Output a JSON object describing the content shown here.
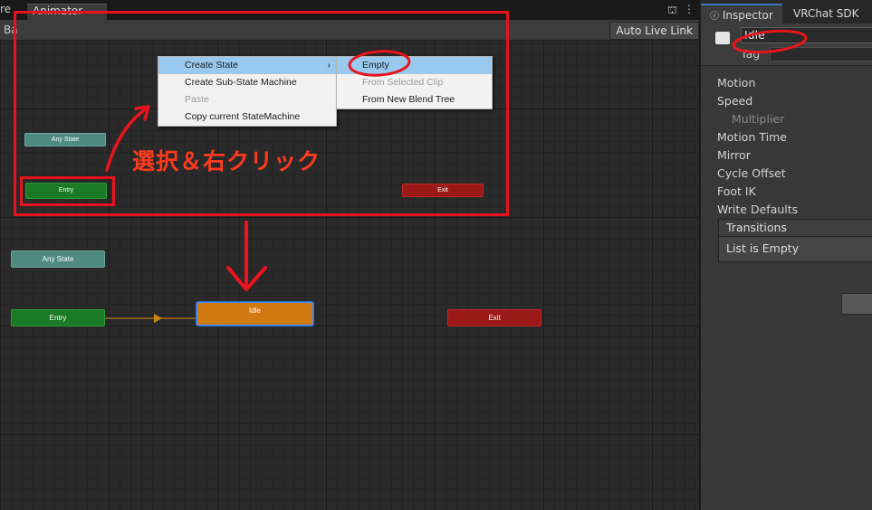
{
  "animator": {
    "tab_left": "re",
    "tab_active": "Animator",
    "toolbar_left": "Ba",
    "auto_live_link": "Auto Live Link",
    "lock_icon": "lock-icon",
    "menu_icon": "kebab-menu-icon"
  },
  "zoomed_view": {
    "any_state": "Any State",
    "entry": "Entry",
    "exit": "Exit",
    "context_menu": [
      {
        "label": "Create State",
        "highlighted": true,
        "has_submenu": true
      },
      {
        "label": "Create Sub-State Machine",
        "disabled": false
      },
      {
        "label": "Paste",
        "disabled": true
      },
      {
        "label": "Copy current StateMachine",
        "disabled": false
      }
    ],
    "submenu": [
      {
        "label": "Empty",
        "highlighted": true
      },
      {
        "label": "From Selected Clip",
        "disabled": true
      },
      {
        "label": "From New Blend Tree",
        "disabled": false
      }
    ],
    "annotation": "選択＆右クリック"
  },
  "result_view": {
    "any_state": "Any State",
    "entry": "Entry",
    "idle": "Idle",
    "exit": "Exit"
  },
  "inspector": {
    "tab_inspector": "Inspector",
    "tab_vrchat": "VRChat SDK",
    "name_value": "Idle",
    "tag_label": "Tag",
    "fields": [
      "Motion",
      "Speed",
      "Multiplier",
      "Motion Time",
      "Mirror",
      "Cycle Offset",
      "Foot IK",
      "Write Defaults"
    ],
    "transitions_header": "Transitions",
    "transitions_empty": "List is Empty"
  },
  "colors": {
    "annotation_red": "#e8141c",
    "entry_green": "#1b7a25",
    "exit_red": "#9a1a1a",
    "idle_orange": "#d27a12",
    "any_state_teal": "#4e8a80",
    "menu_highlight": "#99c9ef"
  }
}
